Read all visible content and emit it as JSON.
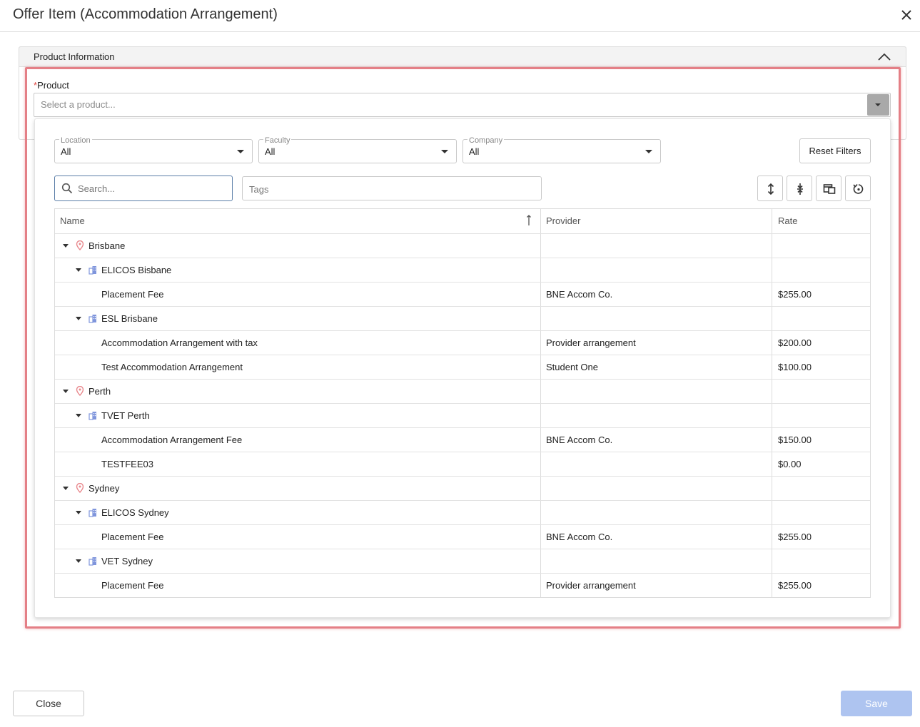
{
  "window": {
    "title": "Offer Item (Accommodation Arrangement)"
  },
  "section": {
    "title": "Product Information"
  },
  "product": {
    "required_mark": "*",
    "label": "Product",
    "placeholder": "Select a product..."
  },
  "filters": [
    {
      "label": "Location",
      "value": "All"
    },
    {
      "label": "Faculty",
      "value": "All"
    },
    {
      "label": "Company",
      "value": "All"
    }
  ],
  "reset_label": "Reset Filters",
  "search": {
    "placeholder": "Search..."
  },
  "tags": {
    "placeholder": "Tags"
  },
  "grid": {
    "columns": [
      "Name",
      "Provider",
      "Rate"
    ],
    "rows": [
      {
        "level": 0,
        "type": "location",
        "name": "Brisbane",
        "provider": "",
        "rate": ""
      },
      {
        "level": 1,
        "type": "faculty",
        "name": "ELICOS Bisbane",
        "provider": "",
        "rate": ""
      },
      {
        "level": 2,
        "type": "product",
        "name": "Placement Fee",
        "provider": "BNE Accom Co.",
        "rate": "$255.00"
      },
      {
        "level": 1,
        "type": "faculty",
        "name": "ESL Brisbane",
        "provider": "",
        "rate": ""
      },
      {
        "level": 2,
        "type": "product",
        "name": "Accommodation Arrangement with tax",
        "provider": "Provider arrangement",
        "rate": "$200.00"
      },
      {
        "level": 2,
        "type": "product",
        "name": "Test Accommodation Arrangement",
        "provider": "Student One",
        "rate": "$100.00"
      },
      {
        "level": 0,
        "type": "location",
        "name": "Perth",
        "provider": "",
        "rate": ""
      },
      {
        "level": 1,
        "type": "faculty",
        "name": "TVET Perth",
        "provider": "",
        "rate": ""
      },
      {
        "level": 2,
        "type": "product",
        "name": "Accommodation Arrangement Fee",
        "provider": "BNE Accom Co.",
        "rate": "$150.00"
      },
      {
        "level": 2,
        "type": "product",
        "name": "TESTFEE03",
        "provider": "",
        "rate": "$0.00"
      },
      {
        "level": 0,
        "type": "location",
        "name": "Sydney",
        "provider": "",
        "rate": ""
      },
      {
        "level": 1,
        "type": "faculty",
        "name": "ELICOS Sydney",
        "provider": "",
        "rate": ""
      },
      {
        "level": 2,
        "type": "product",
        "name": "Placement Fee",
        "provider": "BNE Accom Co.",
        "rate": "$255.00"
      },
      {
        "level": 1,
        "type": "faculty",
        "name": "VET Sydney",
        "provider": "",
        "rate": ""
      },
      {
        "level": 2,
        "type": "product",
        "name": "Placement Fee",
        "provider": "Provider arrangement",
        "rate": "$255.00"
      }
    ]
  },
  "footer": {
    "close_label": "Close",
    "save_label": "Save"
  },
  "colors": {
    "highlight": "#e47f86",
    "location_icon": "#e9898e",
    "faculty_icon": "#7f95dc",
    "save_disabled": "#aec4f0"
  }
}
